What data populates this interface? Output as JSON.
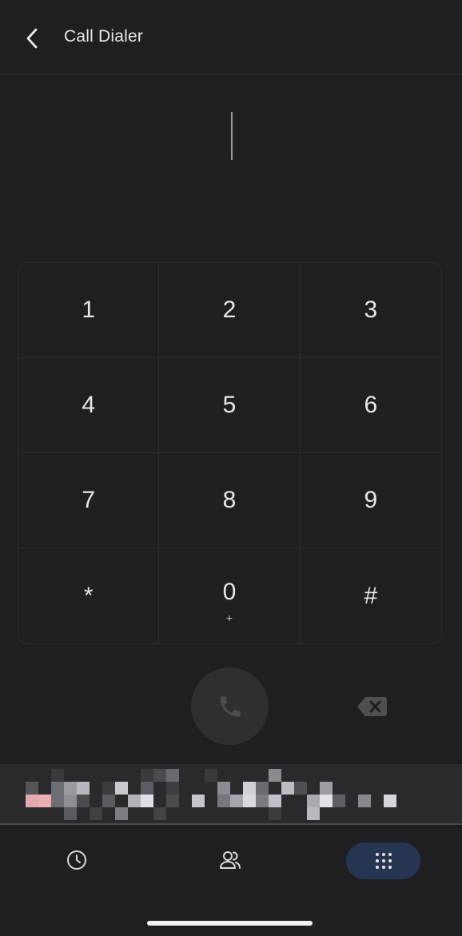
{
  "header": {
    "title": "Call Dialer",
    "back_icon": "chevron-left-icon"
  },
  "dialer": {
    "number": ""
  },
  "keypad": {
    "keys": [
      {
        "digit": "1",
        "sub": ""
      },
      {
        "digit": "2",
        "sub": ""
      },
      {
        "digit": "3",
        "sub": ""
      },
      {
        "digit": "4",
        "sub": ""
      },
      {
        "digit": "5",
        "sub": ""
      },
      {
        "digit": "6",
        "sub": ""
      },
      {
        "digit": "7",
        "sub": ""
      },
      {
        "digit": "8",
        "sub": ""
      },
      {
        "digit": "9",
        "sub": ""
      },
      {
        "digit": "*",
        "sub": ""
      },
      {
        "digit": "0",
        "sub": "+"
      },
      {
        "digit": "#",
        "sub": ""
      }
    ]
  },
  "actions": {
    "call_icon": "phone-icon",
    "backspace_icon": "backspace-icon"
  },
  "banner": {
    "state": "pixelated"
  },
  "bottom_nav": {
    "items": [
      {
        "name": "recents",
        "icon": "clock-icon",
        "active": false
      },
      {
        "name": "contacts",
        "icon": "contacts-icon",
        "active": false
      },
      {
        "name": "keypad",
        "icon": "dialpad-icon",
        "active": true
      }
    ]
  },
  "colors": {
    "background": "#1f1f21",
    "key_text": "#e8e8ea",
    "active_nav": "#263552",
    "call_button": "#2f2f32"
  }
}
